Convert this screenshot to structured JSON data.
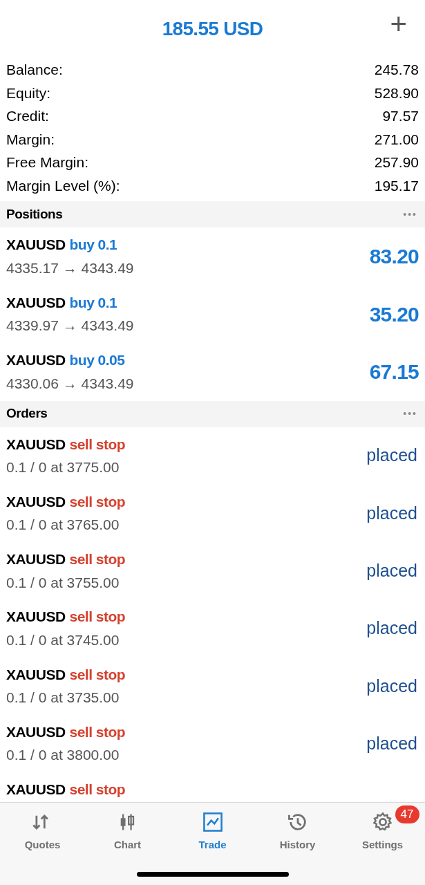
{
  "header": {
    "title": "185.55 USD",
    "add_button": "+"
  },
  "summary": [
    {
      "label": "Balance:",
      "value": "245.78"
    },
    {
      "label": "Equity:",
      "value": "528.90"
    },
    {
      "label": "Credit:",
      "value": "97.57"
    },
    {
      "label": "Margin:",
      "value": "271.00"
    },
    {
      "label": "Free Margin:",
      "value": "257.90"
    },
    {
      "label": "Margin Level (%):",
      "value": "195.17"
    }
  ],
  "positions": {
    "title": "Positions",
    "more": "•••",
    "items": [
      {
        "symbol": "XAUUSD",
        "side": "buy",
        "volume": "0.1",
        "prices": "4335.17 → 4343.49",
        "profit": "83.20"
      },
      {
        "symbol": "XAUUSD",
        "side": "buy",
        "volume": "0.1",
        "prices": "4339.97 → 4343.49",
        "profit": "35.20"
      },
      {
        "symbol": "XAUUSD",
        "side": "buy",
        "volume": "0.05",
        "prices": "4330.06 → 4343.49",
        "profit": "67.15"
      }
    ]
  },
  "orders": {
    "title": "Orders",
    "more": "•••",
    "items": [
      {
        "symbol": "XAUUSD",
        "type": "sell stop",
        "detail": "0.1 / 0 at 3775.00",
        "status": "placed"
      },
      {
        "symbol": "XAUUSD",
        "type": "sell stop",
        "detail": "0.1 / 0 at 3765.00",
        "status": "placed"
      },
      {
        "symbol": "XAUUSD",
        "type": "sell stop",
        "detail": "0.1 / 0 at 3755.00",
        "status": "placed"
      },
      {
        "symbol": "XAUUSD",
        "type": "sell stop",
        "detail": "0.1 / 0 at 3745.00",
        "status": "placed"
      },
      {
        "symbol": "XAUUSD",
        "type": "sell stop",
        "detail": "0.1 / 0 at 3735.00",
        "status": "placed"
      },
      {
        "symbol": "XAUUSD",
        "type": "sell stop",
        "detail": "0.1 / 0 at 3800.00",
        "status": "placed"
      },
      {
        "symbol": "XAUUSD",
        "type": "sell stop"
      }
    ]
  },
  "tab_bar": [
    {
      "label": "Quotes",
      "selected": false
    },
    {
      "label": "Chart",
      "selected": false
    },
    {
      "label": "Trade",
      "selected": true
    },
    {
      "label": "History",
      "selected": false
    },
    {
      "label": "Settings",
      "selected": false,
      "badge": "47"
    }
  ]
}
